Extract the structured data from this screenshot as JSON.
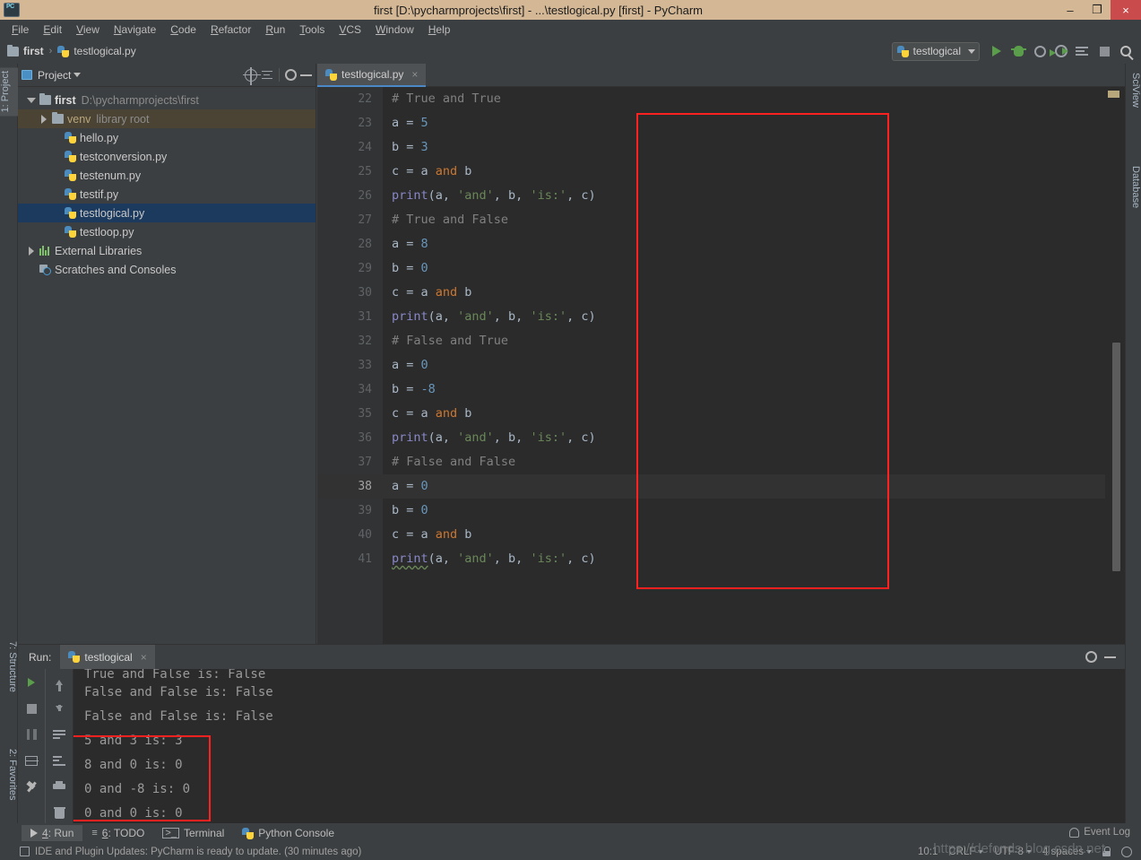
{
  "window": {
    "title": "first [D:\\pycharmprojects\\first] - ...\\testlogical.py [first] - PyCharm",
    "minimize": "–",
    "maximize": "❐",
    "close": "×"
  },
  "menubar": {
    "items": [
      "File",
      "Edit",
      "View",
      "Navigate",
      "Code",
      "Refactor",
      "Run",
      "Tools",
      "VCS",
      "Window",
      "Help"
    ]
  },
  "navbar": {
    "breadcrumb_project": "first",
    "breadcrumb_sep": "›",
    "breadcrumb_file": "testlogical.py",
    "run_config": "testlogical"
  },
  "left_strip": {
    "project_tab": "1: Project",
    "structure_tab": "7: Structure",
    "favorites_tab": "2: Favorites"
  },
  "right_strip": {
    "sciview_tab": "SciView",
    "database_tab": "Database"
  },
  "project_panel": {
    "title": "Project",
    "tree": [
      {
        "label": "first",
        "sub": "D:\\pycharmprojects\\first",
        "indent": 0,
        "arrow": "down",
        "icon": "folder-icon",
        "bold": true,
        "state": "normal"
      },
      {
        "label": "venv",
        "sub": "library root",
        "indent": 1,
        "arrow": "right",
        "icon": "folder-icon",
        "bold": false,
        "state": "venv"
      },
      {
        "label": "hello.py",
        "sub": "",
        "indent": 2,
        "arrow": "none",
        "icon": "python-file-icon",
        "bold": false,
        "state": "normal"
      },
      {
        "label": "testconversion.py",
        "sub": "",
        "indent": 2,
        "arrow": "none",
        "icon": "python-file-icon",
        "bold": false,
        "state": "normal"
      },
      {
        "label": "testenum.py",
        "sub": "",
        "indent": 2,
        "arrow": "none",
        "icon": "python-file-icon",
        "bold": false,
        "state": "normal"
      },
      {
        "label": "testif.py",
        "sub": "",
        "indent": 2,
        "arrow": "none",
        "icon": "python-file-icon",
        "bold": false,
        "state": "normal"
      },
      {
        "label": "testlogical.py",
        "sub": "",
        "indent": 2,
        "arrow": "none",
        "icon": "python-file-icon",
        "bold": false,
        "state": "selected"
      },
      {
        "label": "testloop.py",
        "sub": "",
        "indent": 2,
        "arrow": "none",
        "icon": "python-file-icon",
        "bold": false,
        "state": "normal"
      },
      {
        "label": "External Libraries",
        "sub": "",
        "indent": 0,
        "arrow": "right",
        "icon": "libraries-icon",
        "bold": false,
        "state": "normal"
      },
      {
        "label": "Scratches and Consoles",
        "sub": "",
        "indent": 0,
        "arrow": "none",
        "icon": "scratches-icon",
        "bold": false,
        "state": "normal"
      }
    ]
  },
  "editor": {
    "tab_label": "testlogical.py",
    "tab_close": "×",
    "current_line": 38,
    "lines": [
      {
        "n": 22,
        "tokens": [
          {
            "t": "# True and True",
            "c": "cm"
          }
        ]
      },
      {
        "n": 23,
        "tokens": [
          {
            "t": "a = ",
            "c": ""
          },
          {
            "t": "5",
            "c": "num"
          }
        ]
      },
      {
        "n": 24,
        "tokens": [
          {
            "t": "b = ",
            "c": ""
          },
          {
            "t": "3",
            "c": "num"
          }
        ]
      },
      {
        "n": 25,
        "tokens": [
          {
            "t": "c = a ",
            "c": ""
          },
          {
            "t": "and",
            "c": "kw"
          },
          {
            "t": " b",
            "c": ""
          }
        ]
      },
      {
        "n": 26,
        "tokens": [
          {
            "t": "print",
            "c": "fn"
          },
          {
            "t": "(a, ",
            "c": ""
          },
          {
            "t": "'and'",
            "c": "str"
          },
          {
            "t": ", b, ",
            "c": ""
          },
          {
            "t": "'is:'",
            "c": "str"
          },
          {
            "t": ", c)",
            "c": ""
          }
        ]
      },
      {
        "n": 27,
        "tokens": [
          {
            "t": "# True and False",
            "c": "cm"
          }
        ]
      },
      {
        "n": 28,
        "tokens": [
          {
            "t": "a = ",
            "c": ""
          },
          {
            "t": "8",
            "c": "num"
          }
        ]
      },
      {
        "n": 29,
        "tokens": [
          {
            "t": "b = ",
            "c": ""
          },
          {
            "t": "0",
            "c": "num"
          }
        ]
      },
      {
        "n": 30,
        "tokens": [
          {
            "t": "c = a ",
            "c": ""
          },
          {
            "t": "and",
            "c": "kw"
          },
          {
            "t": " b",
            "c": ""
          }
        ]
      },
      {
        "n": 31,
        "tokens": [
          {
            "t": "print",
            "c": "fn"
          },
          {
            "t": "(a, ",
            "c": ""
          },
          {
            "t": "'and'",
            "c": "str"
          },
          {
            "t": ", b, ",
            "c": ""
          },
          {
            "t": "'is:'",
            "c": "str"
          },
          {
            "t": ", c)",
            "c": ""
          }
        ]
      },
      {
        "n": 32,
        "tokens": [
          {
            "t": "# False and True",
            "c": "cm"
          }
        ]
      },
      {
        "n": 33,
        "tokens": [
          {
            "t": "a = ",
            "c": ""
          },
          {
            "t": "0",
            "c": "num"
          }
        ]
      },
      {
        "n": 34,
        "tokens": [
          {
            "t": "b = ",
            "c": ""
          },
          {
            "t": "-8",
            "c": "num"
          }
        ]
      },
      {
        "n": 35,
        "tokens": [
          {
            "t": "c = a ",
            "c": ""
          },
          {
            "t": "and",
            "c": "kw"
          },
          {
            "t": " b",
            "c": ""
          }
        ]
      },
      {
        "n": 36,
        "tokens": [
          {
            "t": "print",
            "c": "fn"
          },
          {
            "t": "(a, ",
            "c": ""
          },
          {
            "t": "'and'",
            "c": "str"
          },
          {
            "t": ", b, ",
            "c": ""
          },
          {
            "t": "'is:'",
            "c": "str"
          },
          {
            "t": ", c)",
            "c": ""
          }
        ]
      },
      {
        "n": 37,
        "tokens": [
          {
            "t": "# False and False",
            "c": "cm"
          }
        ]
      },
      {
        "n": 38,
        "tokens": [
          {
            "t": "a = ",
            "c": ""
          },
          {
            "t": "0",
            "c": "num"
          }
        ]
      },
      {
        "n": 39,
        "tokens": [
          {
            "t": "b = ",
            "c": ""
          },
          {
            "t": "0",
            "c": "num"
          }
        ]
      },
      {
        "n": 40,
        "tokens": [
          {
            "t": "c = a ",
            "c": ""
          },
          {
            "t": "and",
            "c": "kw"
          },
          {
            "t": " b",
            "c": ""
          }
        ]
      },
      {
        "n": 41,
        "tokens": [
          {
            "t": "print",
            "c": "fn warn"
          },
          {
            "t": "(a, ",
            "c": ""
          },
          {
            "t": "'and'",
            "c": "str"
          },
          {
            "t": ", b, ",
            "c": ""
          },
          {
            "t": "'is:'",
            "c": "str"
          },
          {
            "t": ", c)",
            "c": ""
          }
        ]
      }
    ]
  },
  "run_panel": {
    "label": "Run:",
    "tab_label": "testlogical",
    "tab_close": "×",
    "output_clipped": "True and False is: False",
    "output_lines": [
      "False and False is: False",
      "False and False is: False",
      "5 and 3 is: 3",
      "8 and 0 is: 0",
      "0 and -8 is: 0",
      "0 and 0 is: 0"
    ]
  },
  "bottom_tabs": [
    {
      "label": "4: Run",
      "icon": "play-icon",
      "active": true
    },
    {
      "label": "6: TODO",
      "icon": "list-icon",
      "active": false
    },
    {
      "label": "Terminal",
      "icon": "terminal-icon",
      "active": false
    },
    {
      "label": "Python Console",
      "icon": "python-icon",
      "active": false
    }
  ],
  "status_bar": {
    "message": "IDE and Plugin Updates: PyCharm is ready to update. (30 minutes ago)",
    "caret_position": "10:1",
    "line_separator": "CRLF",
    "encoding": "UTF-8",
    "indent": "4 spaces",
    "event_log": "Event Log"
  },
  "watermark": "https://defonds.blog.csdn.net",
  "colors": {
    "titlebar": "#d4b896",
    "chrome": "#3c3f41",
    "editor_bg": "#2b2b2b",
    "gutter_bg": "#313335",
    "selection": "#1c3a5e",
    "accent_red": "#ff2020",
    "keyword": "#cc7832",
    "number": "#6897bb",
    "string": "#6a8759",
    "function": "#8888c6",
    "comment": "#808080"
  }
}
